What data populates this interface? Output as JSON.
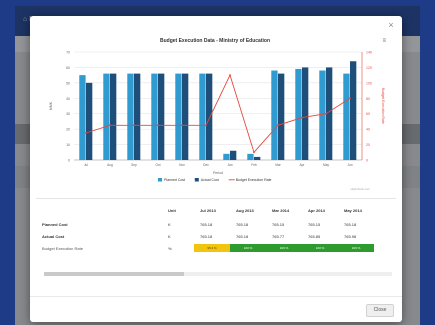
{
  "app": {
    "title": "⌂ Menu",
    "tools": "⚲ ▢"
  },
  "modal": {
    "close_glyph": "×",
    "close_button": "Close"
  },
  "chart": {
    "menu_glyph": "≡"
  },
  "chart_data": {
    "type": "bar",
    "title": "Budget Execution Data - Ministry of Education",
    "xlabel": "Period",
    "ylabel": "MMK",
    "y2label": "Budget Execution Rate",
    "categories": [
      "Jul",
      "Aug",
      "Sep",
      "Oct",
      "Nov",
      "Dec",
      "Jan",
      "Feb",
      "Mar",
      "Apr",
      "May",
      "Jun"
    ],
    "y_ticks": [
      "0",
      "10",
      "20",
      "30",
      "40",
      "50",
      "60",
      "70"
    ],
    "y2_ticks": [
      "0",
      "20",
      "40",
      "60",
      "80",
      "100",
      "120",
      "140"
    ],
    "series": [
      {
        "name": "Planned Cost",
        "type": "bar",
        "color": "#2f9bd1",
        "values": [
          55,
          56,
          56,
          56,
          56,
          56,
          4,
          4,
          58,
          59,
          58,
          56
        ]
      },
      {
        "name": "Actual Cost",
        "type": "bar",
        "color": "#1e4f7a",
        "values": [
          50,
          56,
          56,
          56,
          56,
          56,
          6,
          2,
          56,
          60,
          60,
          64
        ]
      },
      {
        "name": "Budget Execution Rate",
        "type": "line",
        "color": "#e24a3e",
        "values": [
          35,
          45,
          45,
          45,
          45,
          45,
          110,
          10,
          45,
          55,
          60,
          80
        ]
      }
    ],
    "legend": "bottom",
    "credit": "Highcharts.com"
  },
  "table": {
    "headers": [
      "",
      "Unit",
      "Jul 2013",
      "Aug 2013",
      "Mar 2014",
      "Apr 2014",
      "May 2014"
    ],
    "rows": [
      [
        "Planned Cost",
        "K",
        "765.18",
        "765.18",
        "765.15",
        "765.15",
        "765.18"
      ],
      [
        "Actual Cost",
        "K",
        "765.18",
        "765.18",
        "765.77",
        "765.85",
        "765.98"
      ]
    ],
    "gauge_row": {
      "label": "Budget Execution Rate",
      "unit": "%",
      "values": [
        "95.3 %",
        "100 %",
        "100 %",
        "100 %",
        "100 %"
      ],
      "colors": [
        "#f1c40f",
        "#2e9b2e",
        "#2e9b2e",
        "#2e9b2e",
        "#2e9b2e"
      ]
    }
  }
}
